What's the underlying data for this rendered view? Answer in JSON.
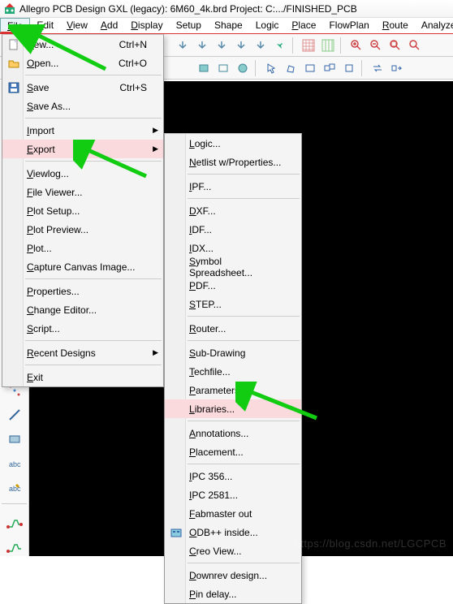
{
  "title": "Allegro PCB Design GXL (legacy): 6M60_4k.brd   Project: C:.../FINISHED_PCB",
  "menubar": [
    "File",
    "Edit",
    "View",
    "Add",
    "Display",
    "Setup",
    "Shape",
    "Logic",
    "Place",
    "FlowPlan",
    "Route",
    "Analyze"
  ],
  "fileMenu": {
    "items": [
      {
        "label": "New...",
        "shortcut": "Ctrl+N",
        "icon": "new"
      },
      {
        "label": "Open...",
        "shortcut": "Ctrl+O",
        "icon": "open"
      },
      {
        "sep": true
      },
      {
        "label": "Save",
        "shortcut": "Ctrl+S",
        "icon": "save"
      },
      {
        "label": "Save As..."
      },
      {
        "sep": true
      },
      {
        "label": "Import",
        "sub": true
      },
      {
        "label": "Export",
        "sub": true,
        "hl": true
      },
      {
        "sep": true
      },
      {
        "label": "Viewlog..."
      },
      {
        "label": "File Viewer..."
      },
      {
        "label": "Plot Setup..."
      },
      {
        "label": "Plot Preview..."
      },
      {
        "label": "Plot..."
      },
      {
        "label": "Capture Canvas Image..."
      },
      {
        "sep": true
      },
      {
        "label": "Properties..."
      },
      {
        "label": "Change Editor..."
      },
      {
        "label": "Script..."
      },
      {
        "sep": true
      },
      {
        "label": "Recent Designs",
        "sub": true
      },
      {
        "sep": true
      },
      {
        "label": "Exit"
      }
    ]
  },
  "exportMenu": {
    "items": [
      {
        "label": "Logic..."
      },
      {
        "label": "Netlist w/Properties..."
      },
      {
        "sep": true
      },
      {
        "label": "IPF..."
      },
      {
        "sep": true
      },
      {
        "label": "DXF..."
      },
      {
        "label": "IDF..."
      },
      {
        "label": "IDX..."
      },
      {
        "label": "Symbol Spreadsheet..."
      },
      {
        "label": "PDF..."
      },
      {
        "label": "STEP..."
      },
      {
        "sep": true
      },
      {
        "label": "Router..."
      },
      {
        "sep": true
      },
      {
        "label": "Sub-Drawing"
      },
      {
        "label": "Techfile..."
      },
      {
        "label": "Parameters..."
      },
      {
        "label": "Libraries...",
        "hl": true
      },
      {
        "sep": true
      },
      {
        "label": "Annotations..."
      },
      {
        "label": "Placement..."
      },
      {
        "sep": true
      },
      {
        "label": "IPC 356..."
      },
      {
        "label": "IPC 2581..."
      },
      {
        "label": "Fabmaster out"
      },
      {
        "label": "ODB++ inside...",
        "icon": "odb"
      },
      {
        "label": "Creo View..."
      },
      {
        "sep": true
      },
      {
        "label": "Downrev design..."
      },
      {
        "label": "Pin delay..."
      }
    ]
  },
  "watermark": "https://blog.csdn.net/LGCPCB"
}
